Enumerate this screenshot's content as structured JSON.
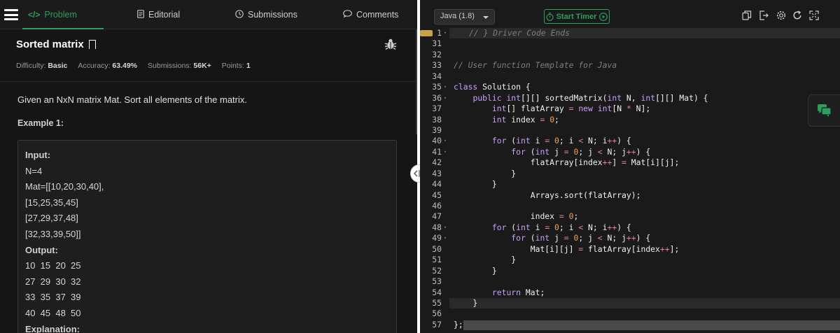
{
  "tabs": [
    {
      "label": "Problem",
      "icon": "code-icon",
      "active": true
    },
    {
      "label": "Editorial",
      "icon": "document-icon"
    },
    {
      "label": "Submissions",
      "icon": "clock-icon"
    },
    {
      "label": "Comments",
      "icon": "comment-icon"
    }
  ],
  "problem": {
    "title": "Sorted matrix",
    "meta": {
      "difficulty_label": "Difficulty:",
      "difficulty": "Basic",
      "accuracy_label": "Accuracy:",
      "accuracy": "63.49%",
      "submissions_label": "Submissions:",
      "submissions": "56K+",
      "points_label": "Points:",
      "points": "1"
    },
    "description": "Given an NxN matrix Mat. Sort all elements of the matrix.",
    "example_heading": "Example 1:",
    "example_lines": [
      {
        "text": "Input:",
        "bold": true
      },
      {
        "text": "N=4"
      },
      {
        "text": "Mat=[[10,20,30,40],"
      },
      {
        "text": "[15,25,35,45]"
      },
      {
        "text": "[27,29,37,48]"
      },
      {
        "text": "[32,33,39,50]]"
      },
      {
        "text": "Output:",
        "bold": true
      },
      {
        "text": "10  15  20  25"
      },
      {
        "text": "27  29  30  32"
      },
      {
        "text": "33  35  37  39"
      },
      {
        "text": "40  45  48  50"
      },
      {
        "text": "Explanation:",
        "bold": true
      }
    ]
  },
  "editor": {
    "language": "Java (1.8)",
    "timer_label": "Start Timer",
    "toolbar_icons": [
      "copy-icon",
      "export-icon",
      "settings-icon",
      "reset-icon",
      "fullscreen-icon"
    ],
    "lines": [
      {
        "n": "1",
        "fold": true,
        "text": "// } Driver Code Ends",
        "hl": true
      },
      {
        "n": "31",
        "text": ""
      },
      {
        "n": "32",
        "text": ""
      },
      {
        "n": "33",
        "text": "// User function Template for Java"
      },
      {
        "n": "34",
        "text": ""
      },
      {
        "n": "35",
        "fold": true,
        "text": "class Solution {"
      },
      {
        "n": "36",
        "fold": true,
        "text": "    public int[][] sortedMatrix(int N, int[][] Mat) {"
      },
      {
        "n": "37",
        "text": "        int[] flatArray = new int[N * N];"
      },
      {
        "n": "38",
        "text": "        int index = 0;"
      },
      {
        "n": "39",
        "text": ""
      },
      {
        "n": "40",
        "fold": true,
        "text": "        for (int i = 0; i < N; i++) {"
      },
      {
        "n": "41",
        "fold": true,
        "text": "            for (int j = 0; j < N; j++) {"
      },
      {
        "n": "42",
        "text": "                flatArray[index++] = Mat[i][j];"
      },
      {
        "n": "43",
        "text": "            }"
      },
      {
        "n": "44",
        "text": "        }"
      },
      {
        "n": "45",
        "text": "                Arrays.sort(flatArray);"
      },
      {
        "n": "46",
        "text": ""
      },
      {
        "n": "47",
        "text": "                index = 0;"
      },
      {
        "n": "48",
        "fold": true,
        "text": "        for (int i = 0; i < N; i++) {"
      },
      {
        "n": "49",
        "fold": true,
        "text": "            for (int j = 0; j < N; j++) {"
      },
      {
        "n": "50",
        "text": "                Mat[i][j] = flatArray[index++];"
      },
      {
        "n": "51",
        "text": "            }"
      },
      {
        "n": "52",
        "text": "        }"
      },
      {
        "n": "53",
        "text": ""
      },
      {
        "n": "54",
        "text": "        return Mat;"
      },
      {
        "n": "55",
        "text": "    }",
        "hl": true
      },
      {
        "n": "56",
        "text": ""
      },
      {
        "n": "57",
        "text": "};",
        "hl2": true
      }
    ]
  },
  "colors": {
    "accent": "#2f9e5b",
    "background": "#151515",
    "editor_bg": "#1a1a1a"
  }
}
